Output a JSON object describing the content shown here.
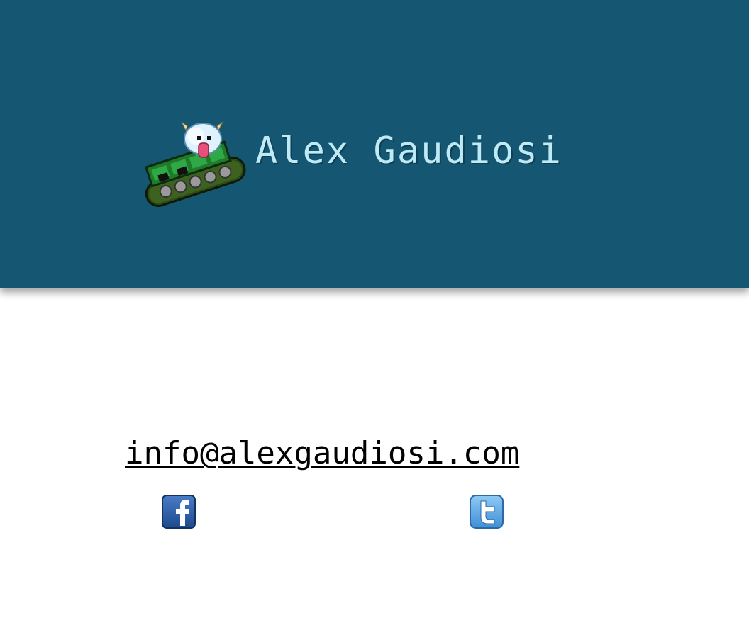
{
  "header": {
    "title": "Alex Gaudiosi",
    "logo_icon": "tank-with-poro-icon",
    "background_color": "#155773",
    "title_color": "#bdeaf5"
  },
  "contact": {
    "email": "info@alexgaudiosi.com",
    "email_href": "mailto:info@alexgaudiosi.com"
  },
  "social": [
    {
      "name": "facebook",
      "icon": "facebook-icon",
      "color": "#2d5aa6"
    },
    {
      "name": "twitter",
      "icon": "twitter-icon",
      "color": "#5aa8e6"
    }
  ]
}
